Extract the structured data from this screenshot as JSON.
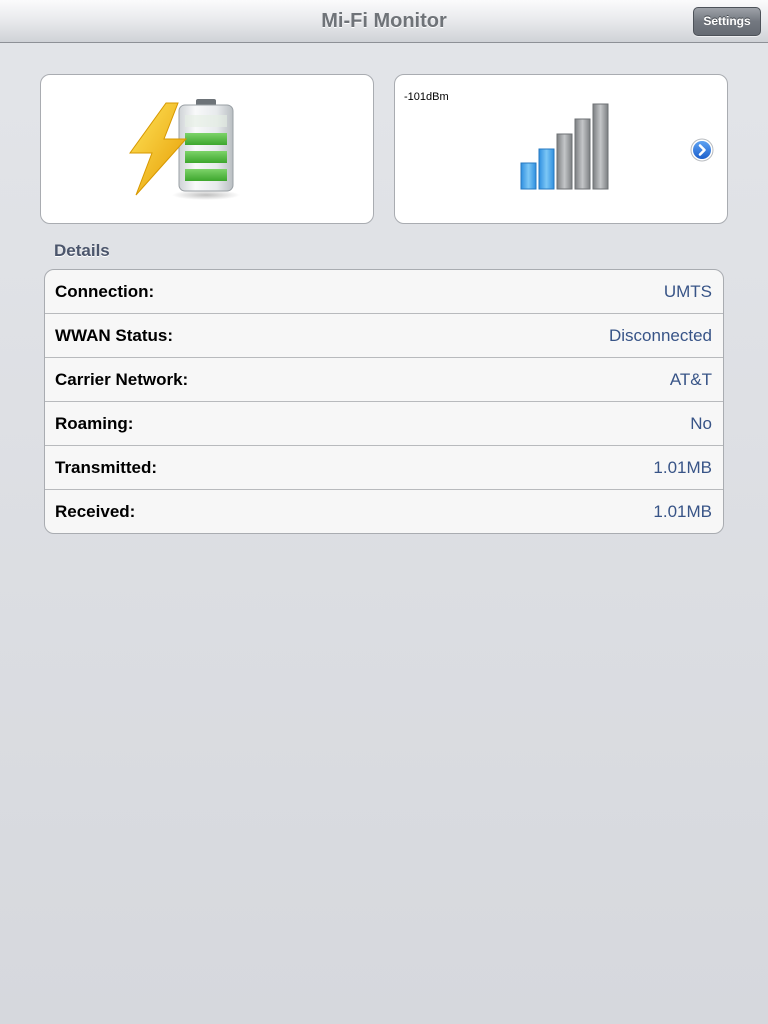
{
  "navbar": {
    "title": "Mi-Fi Monitor",
    "settings_label": "Settings"
  },
  "battery": {
    "icon": "battery-charging-icon",
    "charging": true,
    "level_bars_filled": 3,
    "level_bars_total": 3
  },
  "signal": {
    "strength_label": "-101dBm",
    "icon": "signal-strength-icon",
    "bars_active": 2,
    "bars_total": 5,
    "disclosure_icon": "chevron-right-circle-icon"
  },
  "details": {
    "header": "Details",
    "rows": [
      {
        "label": "Connection:",
        "value": "UMTS"
      },
      {
        "label": "WWAN Status:",
        "value": "Disconnected"
      },
      {
        "label": "Carrier Network:",
        "value": "AT&T"
      },
      {
        "label": "Roaming:",
        "value": "No"
      },
      {
        "label": "Transmitted:",
        "value": "1.01MB"
      },
      {
        "label": "Received:",
        "value": "1.01MB"
      }
    ]
  },
  "colors": {
    "value_text": "#385487",
    "signal_active": "#4aa9ec",
    "signal_inactive": "#9a9a9a",
    "battery_cell": "#4bb73a",
    "bolt": "#f2b90c"
  }
}
